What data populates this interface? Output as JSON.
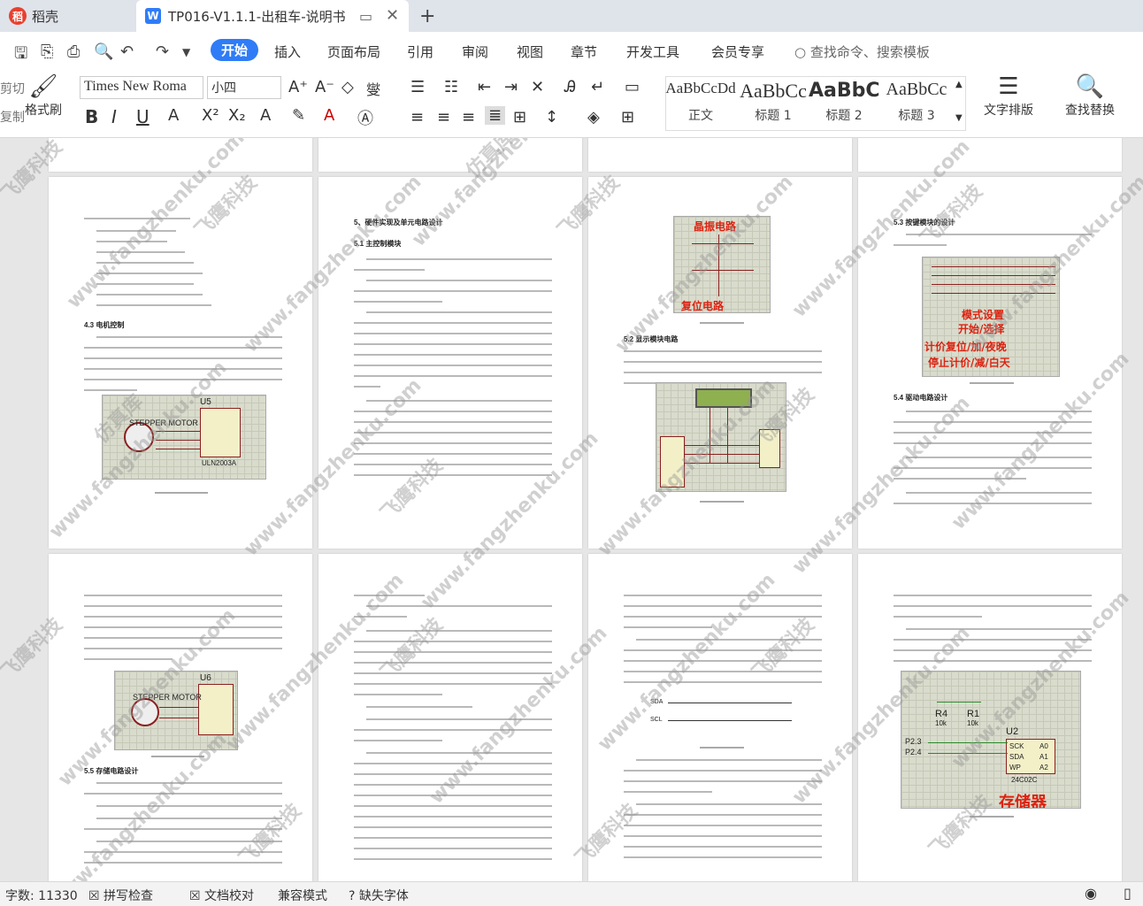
{
  "tabs": {
    "home_label": "稻壳",
    "doc_label": "TP016-V1.1.1-出租车-说明书"
  },
  "menu": {
    "items": [
      "开始",
      "插入",
      "页面布局",
      "引用",
      "审阅",
      "视图",
      "章节",
      "开发工具",
      "会员专享"
    ],
    "active": "开始",
    "search_command": "查找命令、搜索模板"
  },
  "toolbar": {
    "cut": "剪切",
    "copy": "复制",
    "format_painter": "格式刷",
    "font_name": "Times New Roma",
    "font_size": "小四",
    "text_layout": "文字排版",
    "find_replace": "查找替换"
  },
  "styles": [
    {
      "sample": "AaBbCcDd",
      "name": "正文"
    },
    {
      "sample": "AaBbCc",
      "name": "标题 1"
    },
    {
      "sample": "AaBbC",
      "name": "标题 2"
    },
    {
      "sample": "AaBbCc",
      "name": "标题 3"
    }
  ],
  "pages": {
    "p1_heading": "4.3  电机控制",
    "p1_figure_label": "STEPPER MOTOR",
    "p1_chip": "ULN2003A",
    "p1_u": "U5",
    "p2_heading": "5、硬件实现及单元电路设计",
    "p2_sub": "5.1 主控制模块",
    "p3_fig_label_top": "晶振电路",
    "p3_fig_label_bottom": "复位电路",
    "p3_sub": "5.2 显示模块电路",
    "p4_heading": "5.3  按键模块的设计",
    "p4_keys": [
      "模式设置",
      "开始/选择",
      "计价复位/加/夜晚",
      "停止计价/减/白天"
    ],
    "p4_sub": "5.4  驱动电路设计",
    "p5_u": "U6",
    "p5_figure_label": "STEPPER MOTOR",
    "p5_sub": "5.5  存储电路设计",
    "p7_wave_sda": "SDA",
    "p7_wave_scl": "SCL",
    "p8_r4": "R4",
    "p8_r1": "R1",
    "p8_chip": "U2",
    "p8_chip_name": "24C02C",
    "p8_storage": "存储器",
    "p8_pins": [
      "SCK",
      "SDA",
      "WP",
      "A0",
      "A1",
      "A2"
    ],
    "p8_ports": [
      "P2.3",
      "P2.4"
    ],
    "p8_val": "10k"
  },
  "watermark": {
    "text_cn": "飞鹰科技",
    "text_url": "www.fangzhenku.com",
    "text_cn2": "仿真库"
  },
  "status": {
    "word_count": "字数: 11330",
    "spell_check": "拼写检查",
    "doc_proof": "文档校对",
    "compat_mode": "兼容模式",
    "missing_font": "缺失字体"
  },
  "colors": {
    "accent": "#2f7cf6",
    "brand_red": "#e8402f",
    "schematic_bg": "#d9dccc",
    "label_red": "#d21111"
  }
}
